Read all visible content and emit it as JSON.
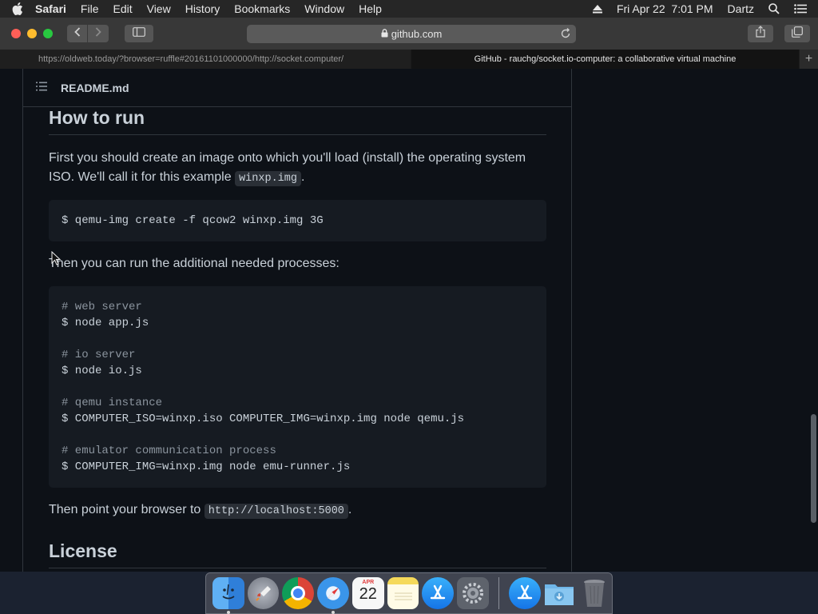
{
  "menubar": {
    "app_name": "Safari",
    "items": [
      "File",
      "Edit",
      "View",
      "History",
      "Bookmarks",
      "Window",
      "Help"
    ],
    "datetime": "Fri Apr 22  7:01 PM",
    "user": "Dartz"
  },
  "toolbar": {
    "address": "github.com"
  },
  "tabs": [
    {
      "label": "https://oldweb.today/?browser=ruffle#20161101000000/http://socket.computer/",
      "active": false
    },
    {
      "label": "GitHub - rauchg/socket.io-computer: a collaborative virtual machine",
      "active": true
    }
  ],
  "readme": {
    "filename": "README.md",
    "how_to_run_heading": "How to run",
    "para1_before": "First you should create an image onto which you'll load (install) the operating system ISO. We'll call it for this example ",
    "para1_code": "winxp.img",
    "para1_after": ".",
    "code1": "$ qemu-img create -f qcow2 winxp.img 3G",
    "para2": "Then you can run the additional needed processes:",
    "code2_lines": [
      {
        "text": "# web server",
        "comment": true
      },
      {
        "text": "$ node app.js",
        "comment": false
      },
      {
        "text": "",
        "comment": false
      },
      {
        "text": "# io server",
        "comment": true
      },
      {
        "text": "$ node io.js",
        "comment": false
      },
      {
        "text": "",
        "comment": false
      },
      {
        "text": "# qemu instance",
        "comment": true
      },
      {
        "text": "$ COMPUTER_ISO=winxp.iso COMPUTER_IMG=winxp.img node qemu.js",
        "comment": false
      },
      {
        "text": "",
        "comment": false
      },
      {
        "text": "# emulator communication process",
        "comment": true
      },
      {
        "text": "$ COMPUTER_IMG=winxp.img node emu-runner.js",
        "comment": false
      }
    ],
    "para3_before": "Then point your browser to ",
    "para3_code": "http://localhost:5000",
    "para3_after": ".",
    "license_heading": "License"
  },
  "dock": {
    "items": [
      {
        "name": "finder-icon",
        "color": "#3a8ee6",
        "running": true
      },
      {
        "name": "launchpad-icon",
        "color": "#7a7f8a",
        "running": false
      },
      {
        "name": "chrome-icon",
        "color": "#e9e9e9",
        "running": false
      },
      {
        "name": "safari-icon",
        "color": "#2f86e0",
        "running": true
      },
      {
        "name": "calendar-icon",
        "color": "#f4f4f4",
        "running": false,
        "label_month": "APR",
        "label_day": "22"
      },
      {
        "name": "notes-icon",
        "color": "#f5d95a",
        "running": false
      },
      {
        "name": "app-store-icon",
        "color": "#1e8ef0",
        "running": false
      },
      {
        "name": "system-preferences-icon",
        "color": "#8a8f98",
        "running": false
      }
    ],
    "right_items": [
      {
        "name": "app-store-folder-icon",
        "color": "#1e8ef0"
      },
      {
        "name": "downloads-folder-icon",
        "color": "#6fb6e8"
      },
      {
        "name": "trash-icon",
        "color": "#6d7078"
      }
    ]
  }
}
